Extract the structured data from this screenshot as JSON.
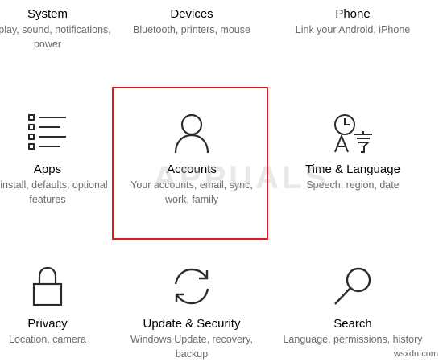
{
  "tiles": {
    "system": {
      "title": "System",
      "desc": "Display, sound, notifications, power",
      "icon": "laptop-icon"
    },
    "devices": {
      "title": "Devices",
      "desc": "Bluetooth, printers, mouse",
      "icon": "keyboard-icon"
    },
    "phone": {
      "title": "Phone",
      "desc": "Link your Android, iPhone",
      "icon": "phone-icon"
    },
    "apps": {
      "title": "Apps",
      "desc": "Uninstall, defaults, optional features",
      "icon": "apps-list-icon"
    },
    "accounts": {
      "title": "Accounts",
      "desc": "Your accounts, email, sync, work, family",
      "icon": "person-icon"
    },
    "time": {
      "title": "Time & Language",
      "desc": "Speech, region, date",
      "icon": "time-language-icon"
    },
    "privacy": {
      "title": "Privacy",
      "desc": "Location, camera",
      "icon": "lock-icon"
    },
    "update": {
      "title": "Update & Security",
      "desc": "Windows Update, recovery, backup",
      "icon": "sync-icon"
    },
    "search": {
      "title": "Search",
      "desc": "Language, permissions, history",
      "icon": "search-icon"
    }
  },
  "highlight_color": "#e3191c",
  "watermark": {
    "logo": "APPUALS",
    "site": "wsxdn.com"
  }
}
